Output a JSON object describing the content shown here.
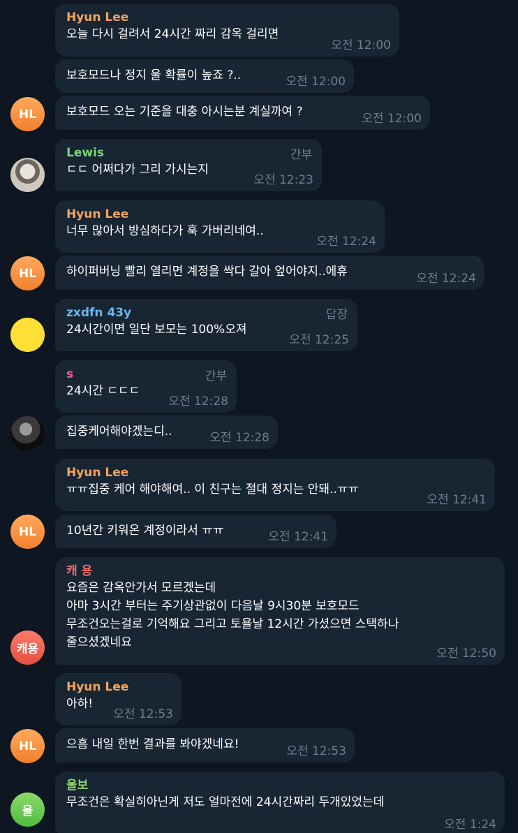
{
  "colors": {
    "background": "#0e1621",
    "bubble": "#182533",
    "time": "#6d7f8f",
    "name_hyun": "#f5a45c",
    "name_lewis": "#7bd37a",
    "name_zxdfn": "#67b8ef",
    "name_s": "#ee5e92",
    "name_kaeyong": "#ff6b6b",
    "name_ulbo": "#8fd86a"
  },
  "messages": [
    {
      "name": "Hyun Lee",
      "text": "오늘 다시 걸려서 24시간 짜리 감옥 걸리면",
      "time": "오전 12:00"
    },
    {
      "text": "보호모드나 정지 울 확률이 높죠 ?..",
      "time": "오전 12:00"
    },
    {
      "text": "보호모드 오는 기준을 대충 아시는분 계실까여 ?",
      "time": "오전 12:00",
      "avatar": "HL"
    },
    {
      "name": "Lewis",
      "tag": "간부",
      "text": "ㄷㄷ 어쩌다가 그리 가시는지",
      "time": "오전 12:23",
      "avatar_icon": "user-photo-icon"
    },
    {
      "name": "Hyun Lee",
      "text": "너무 많아서 방심하다가 훅 가버리네여..",
      "time": "오전 12:24"
    },
    {
      "text": "하이퍼버닝 빨리 열리면 계정을 싹다 갈아 엎어야지..에휴",
      "time": "오전 12:24",
      "avatar": "HL"
    },
    {
      "name": "zxdfn 43y",
      "tag": "답장",
      "text": "24시간이면 일단 보모는 100%오져",
      "time": "오전 12:25"
    },
    {
      "name": "s",
      "tag": "간부",
      "text": "24시간 ㄷㄷㄷ",
      "time": "오전 12:28"
    },
    {
      "text": "집중케어해야겠는디..",
      "time": "오전 12:28",
      "avatar_icon": "user-photo-icon"
    },
    {
      "name": "Hyun Lee",
      "text": "ㅠㅠ집중 케어 해야해여.. 이 친구는 절대 정지는 안돼..ㅠㅠ",
      "time": "오전 12:41"
    },
    {
      "text": "10년간 키워온 계정이라서 ㅠㅠ",
      "time": "오전 12:41",
      "avatar": "HL"
    },
    {
      "name": "캐 용",
      "text": "요즘은 감옥안가서 모르겠는데\n아마 3시간 부터는 주기상관없이 다음날 9시30분 보호모드\n무조건오는걸로 기억해요 그리고 토욜날 12시간 가셨으면 스택하나\n줄으셨겠네요",
      "time": "오전 12:50",
      "avatar": "캐용"
    },
    {
      "name": "Hyun Lee",
      "text": "아하!",
      "time": "오전 12:53"
    },
    {
      "text": "으흠 내일 한번 결과를 봐야겠네요!",
      "time": "오전 12:53",
      "avatar": "HL"
    },
    {
      "name": "울보",
      "text": "무조건은 확실히아닌게 저도 얼마전에 24시간짜리 두개있었는데",
      "time": "오전 1:24",
      "avatar": "울"
    }
  ]
}
